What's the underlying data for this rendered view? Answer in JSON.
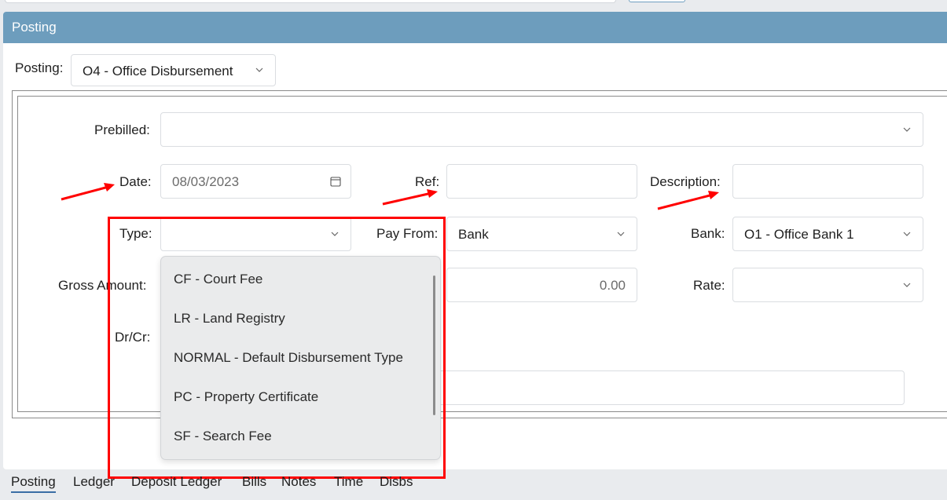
{
  "panel": {
    "title": "Posting"
  },
  "posting": {
    "label": "Posting:",
    "value": "O4 - Office Disbursement"
  },
  "form": {
    "prebilled": {
      "label": "Prebilled:",
      "value": ""
    },
    "date": {
      "label": "Date:",
      "value": "08/03/2023"
    },
    "ref": {
      "label": "Ref:",
      "value": ""
    },
    "description": {
      "label": "Description:",
      "value": ""
    },
    "type": {
      "label": "Type:",
      "value": ""
    },
    "pay_from": {
      "label": "Pay From:",
      "value": "Bank"
    },
    "bank": {
      "label": "Bank:",
      "value": "O1 - Office Bank 1"
    },
    "gross_amount": {
      "label": "Gross Amount:",
      "value": "0.00"
    },
    "rate": {
      "label": "Rate:",
      "value": ""
    },
    "drcr": {
      "label": "Dr/Cr:"
    }
  },
  "type_dropdown": {
    "options": [
      "CF - Court Fee",
      "LR - Land Registry",
      "NORMAL - Default Disbursement Type",
      "PC - Property Certificate",
      "SF - Search Fee"
    ]
  },
  "tabs": [
    "Posting",
    "Ledger",
    "Deposit Ledger",
    "Bills",
    "Notes",
    "Time",
    "Disbs"
  ],
  "colors": {
    "header": "#6d9dbd",
    "annotation": "#ff0000",
    "active_tab": "#3b6ea5"
  },
  "icons": {
    "chevron": "chevron-down-icon",
    "calendar": "calendar-icon",
    "arrow": "red-arrow-annotation"
  }
}
